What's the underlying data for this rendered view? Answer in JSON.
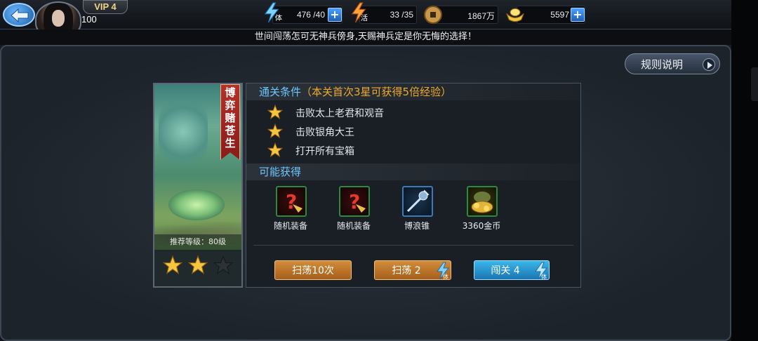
{
  "header": {
    "vip_label": "VIP 4",
    "player_level": "100",
    "stamina": {
      "icon": "stamina-bolt-icon",
      "label": "体",
      "value": "476 /40"
    },
    "activity": {
      "icon": "activity-bolt-icon",
      "label": "活",
      "value": "33 /35"
    },
    "coins": {
      "icon": "copper-coin-icon",
      "value": "1867万"
    },
    "ingots": {
      "icon": "gold-ingot-icon",
      "value": "5597"
    },
    "plus_label": "+"
  },
  "marquee": "世间闯荡怎可无神兵傍身,天赐神兵定是你无悔的选择！",
  "rules_button": "规则说明",
  "stage": {
    "name": "博弈赌苍生",
    "recommended_level": "推荐等级：80级",
    "stars_earned": 2,
    "stars_total": 3
  },
  "conditions": {
    "title": "通关条件",
    "bonus": "（本关首次3星可获得5倍经验）",
    "items": [
      "击败太上老君和观音",
      "击败银角大王",
      "打开所有宝箱"
    ]
  },
  "drops": {
    "title": "可能获得",
    "items": [
      {
        "label": "随机装备",
        "icon": "random-equipment-icon"
      },
      {
        "label": "随机装备",
        "icon": "random-equipment-icon"
      },
      {
        "label": "博浪锥",
        "icon": "bolangzhui-weapon-icon"
      },
      {
        "label": "3360金币",
        "icon": "gold-coins-icon"
      }
    ]
  },
  "actions": {
    "sweep10": "扫荡10次",
    "sweep": "扫荡 2",
    "challenge": "闯关 4",
    "cost_label": "体"
  },
  "colors": {
    "accent_blue": "#6ec7ff",
    "highlight_orange": "#f0a92a",
    "button_orange": "#c07a2c",
    "button_blue": "#2a98d0",
    "ribbon_red": "#a3261f"
  }
}
